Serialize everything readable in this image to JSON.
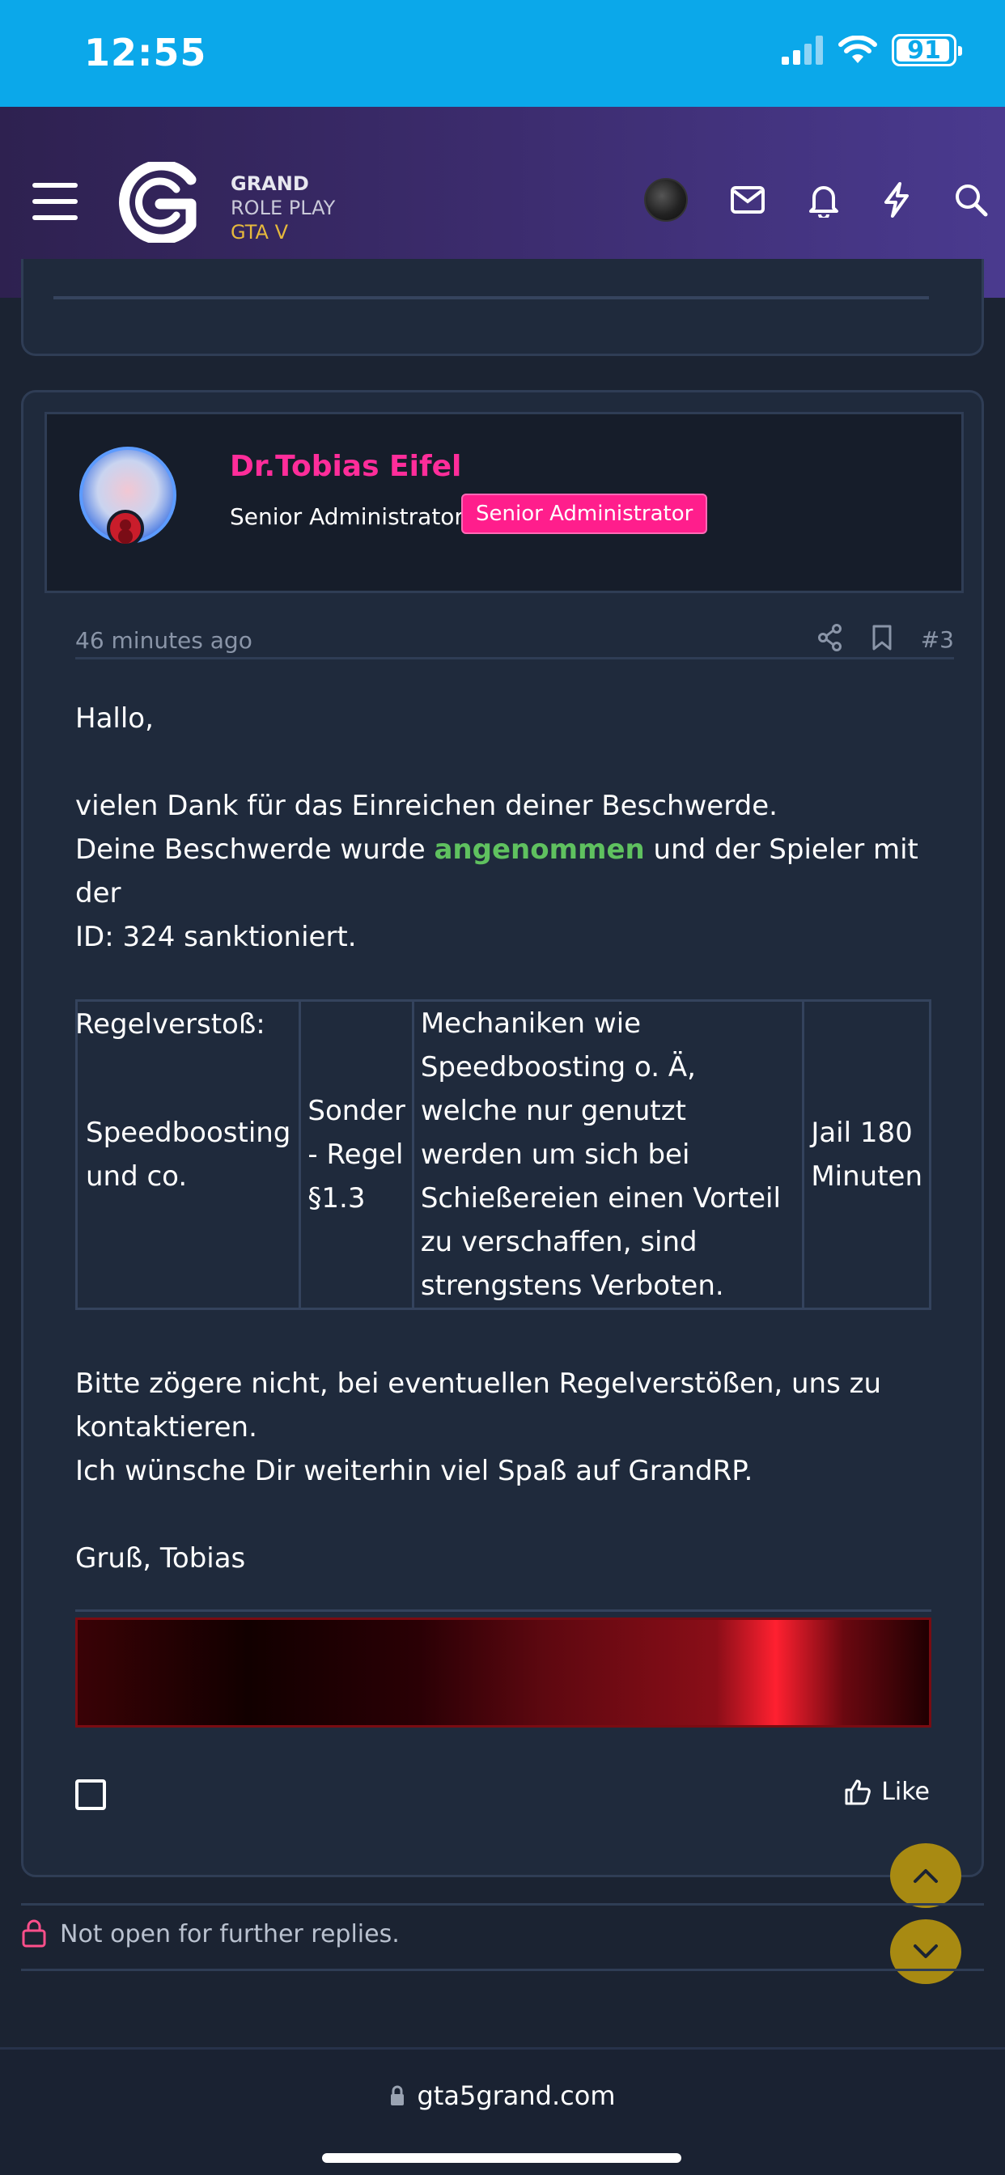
{
  "status_bar": {
    "time": "12:55",
    "battery": "91"
  },
  "header": {
    "logo_line1": "GRAND",
    "logo_line2": "ROLE PLAY",
    "logo_line3": "GTA V",
    "icons": [
      "menu-icon",
      "avatar",
      "mail-icon",
      "bell-icon",
      "bolt-icon",
      "search-icon"
    ]
  },
  "post": {
    "author": {
      "name": "Dr.Tobias Eifel",
      "title": "Senior Administrator",
      "badge": "Senior Administrator"
    },
    "time": "46 minutes ago",
    "number": "#3",
    "greeting": "Hallo,",
    "line1": "vielen Dank für das Einreichen deiner Beschwerde.",
    "line2_pre": "Deine Beschwerde wurde ",
    "line2_accent": "angenommen",
    "line2_post": " und der Spieler mit der",
    "line3": "ID: 324 sanktioniert.",
    "rules_heading": "Regelverstoß:",
    "table": {
      "rows": [
        {
          "offense": "Speedboosting und co.",
          "rule": "Sonder - Regel §1.3",
          "description": "Mechaniken wie Speedboosting o. Ä, welche nur genutzt werden um sich bei Schießereien einen Vorteil zu verschaffen, sind strengstens Verboten.",
          "penalty": "Jail 180 Minuten"
        }
      ]
    },
    "closing1": "Bitte zögere nicht, bei eventuellen Regelverstößen, uns zu kontaktieren.",
    "closing2": "Ich wünsche Dir weiterhin viel Spaß auf GrandRP.",
    "signoff": "Gruß, Tobias",
    "like_label": "Like"
  },
  "notice": {
    "text": "Not open for further replies."
  },
  "browser": {
    "url": "gta5grand.com"
  },
  "colors": {
    "status_bar": "#0ba8ea",
    "author_name": "#ff2d9a",
    "role_badge": "#ff1e8c",
    "accepted": "#5fc15f",
    "scroll_button": "#a88a12"
  }
}
